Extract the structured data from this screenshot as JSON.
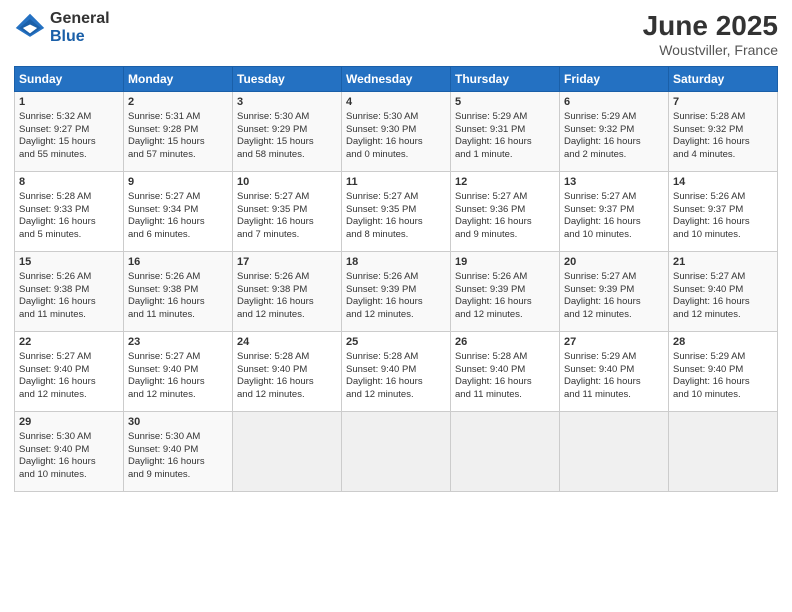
{
  "header": {
    "logo_general": "General",
    "logo_blue": "Blue",
    "main_title": "June 2025",
    "subtitle": "Woustviller, France"
  },
  "calendar": {
    "days_of_week": [
      "Sunday",
      "Monday",
      "Tuesday",
      "Wednesday",
      "Thursday",
      "Friday",
      "Saturday"
    ],
    "weeks": [
      [
        {
          "day": "",
          "empty": true
        },
        {
          "day": "",
          "empty": true
        },
        {
          "day": "",
          "empty": true
        },
        {
          "day": "",
          "empty": true
        },
        {
          "day": "",
          "empty": true
        },
        {
          "day": "",
          "empty": true
        },
        {
          "day": "",
          "empty": true
        }
      ],
      [
        {
          "day": "1",
          "lines": [
            "Sunrise: 5:32 AM",
            "Sunset: 9:27 PM",
            "Daylight: 15 hours",
            "and 55 minutes."
          ]
        },
        {
          "day": "2",
          "lines": [
            "Sunrise: 5:31 AM",
            "Sunset: 9:28 PM",
            "Daylight: 15 hours",
            "and 57 minutes."
          ]
        },
        {
          "day": "3",
          "lines": [
            "Sunrise: 5:30 AM",
            "Sunset: 9:29 PM",
            "Daylight: 15 hours",
            "and 58 minutes."
          ]
        },
        {
          "day": "4",
          "lines": [
            "Sunrise: 5:30 AM",
            "Sunset: 9:30 PM",
            "Daylight: 16 hours",
            "and 0 minutes."
          ]
        },
        {
          "day": "5",
          "lines": [
            "Sunrise: 5:29 AM",
            "Sunset: 9:31 PM",
            "Daylight: 16 hours",
            "and 1 minute."
          ]
        },
        {
          "day": "6",
          "lines": [
            "Sunrise: 5:29 AM",
            "Sunset: 9:32 PM",
            "Daylight: 16 hours",
            "and 2 minutes."
          ]
        },
        {
          "day": "7",
          "lines": [
            "Sunrise: 5:28 AM",
            "Sunset: 9:32 PM",
            "Daylight: 16 hours",
            "and 4 minutes."
          ]
        }
      ],
      [
        {
          "day": "8",
          "lines": [
            "Sunrise: 5:28 AM",
            "Sunset: 9:33 PM",
            "Daylight: 16 hours",
            "and 5 minutes."
          ]
        },
        {
          "day": "9",
          "lines": [
            "Sunrise: 5:27 AM",
            "Sunset: 9:34 PM",
            "Daylight: 16 hours",
            "and 6 minutes."
          ]
        },
        {
          "day": "10",
          "lines": [
            "Sunrise: 5:27 AM",
            "Sunset: 9:35 PM",
            "Daylight: 16 hours",
            "and 7 minutes."
          ]
        },
        {
          "day": "11",
          "lines": [
            "Sunrise: 5:27 AM",
            "Sunset: 9:35 PM",
            "Daylight: 16 hours",
            "and 8 minutes."
          ]
        },
        {
          "day": "12",
          "lines": [
            "Sunrise: 5:27 AM",
            "Sunset: 9:36 PM",
            "Daylight: 16 hours",
            "and 9 minutes."
          ]
        },
        {
          "day": "13",
          "lines": [
            "Sunrise: 5:27 AM",
            "Sunset: 9:37 PM",
            "Daylight: 16 hours",
            "and 10 minutes."
          ]
        },
        {
          "day": "14",
          "lines": [
            "Sunrise: 5:26 AM",
            "Sunset: 9:37 PM",
            "Daylight: 16 hours",
            "and 10 minutes."
          ]
        }
      ],
      [
        {
          "day": "15",
          "lines": [
            "Sunrise: 5:26 AM",
            "Sunset: 9:38 PM",
            "Daylight: 16 hours",
            "and 11 minutes."
          ]
        },
        {
          "day": "16",
          "lines": [
            "Sunrise: 5:26 AM",
            "Sunset: 9:38 PM",
            "Daylight: 16 hours",
            "and 11 minutes."
          ]
        },
        {
          "day": "17",
          "lines": [
            "Sunrise: 5:26 AM",
            "Sunset: 9:38 PM",
            "Daylight: 16 hours",
            "and 12 minutes."
          ]
        },
        {
          "day": "18",
          "lines": [
            "Sunrise: 5:26 AM",
            "Sunset: 9:39 PM",
            "Daylight: 16 hours",
            "and 12 minutes."
          ]
        },
        {
          "day": "19",
          "lines": [
            "Sunrise: 5:26 AM",
            "Sunset: 9:39 PM",
            "Daylight: 16 hours",
            "and 12 minutes."
          ]
        },
        {
          "day": "20",
          "lines": [
            "Sunrise: 5:27 AM",
            "Sunset: 9:39 PM",
            "Daylight: 16 hours",
            "and 12 minutes."
          ]
        },
        {
          "day": "21",
          "lines": [
            "Sunrise: 5:27 AM",
            "Sunset: 9:40 PM",
            "Daylight: 16 hours",
            "and 12 minutes."
          ]
        }
      ],
      [
        {
          "day": "22",
          "lines": [
            "Sunrise: 5:27 AM",
            "Sunset: 9:40 PM",
            "Daylight: 16 hours",
            "and 12 minutes."
          ]
        },
        {
          "day": "23",
          "lines": [
            "Sunrise: 5:27 AM",
            "Sunset: 9:40 PM",
            "Daylight: 16 hours",
            "and 12 minutes."
          ]
        },
        {
          "day": "24",
          "lines": [
            "Sunrise: 5:28 AM",
            "Sunset: 9:40 PM",
            "Daylight: 16 hours",
            "and 12 minutes."
          ]
        },
        {
          "day": "25",
          "lines": [
            "Sunrise: 5:28 AM",
            "Sunset: 9:40 PM",
            "Daylight: 16 hours",
            "and 12 minutes."
          ]
        },
        {
          "day": "26",
          "lines": [
            "Sunrise: 5:28 AM",
            "Sunset: 9:40 PM",
            "Daylight: 16 hours",
            "and 11 minutes."
          ]
        },
        {
          "day": "27",
          "lines": [
            "Sunrise: 5:29 AM",
            "Sunset: 9:40 PM",
            "Daylight: 16 hours",
            "and 11 minutes."
          ]
        },
        {
          "day": "28",
          "lines": [
            "Sunrise: 5:29 AM",
            "Sunset: 9:40 PM",
            "Daylight: 16 hours",
            "and 10 minutes."
          ]
        }
      ],
      [
        {
          "day": "29",
          "lines": [
            "Sunrise: 5:30 AM",
            "Sunset: 9:40 PM",
            "Daylight: 16 hours",
            "and 10 minutes."
          ]
        },
        {
          "day": "30",
          "lines": [
            "Sunrise: 5:30 AM",
            "Sunset: 9:40 PM",
            "Daylight: 16 hours",
            "and 9 minutes."
          ]
        },
        {
          "day": "",
          "empty": true
        },
        {
          "day": "",
          "empty": true
        },
        {
          "day": "",
          "empty": true
        },
        {
          "day": "",
          "empty": true
        },
        {
          "day": "",
          "empty": true
        }
      ]
    ]
  }
}
